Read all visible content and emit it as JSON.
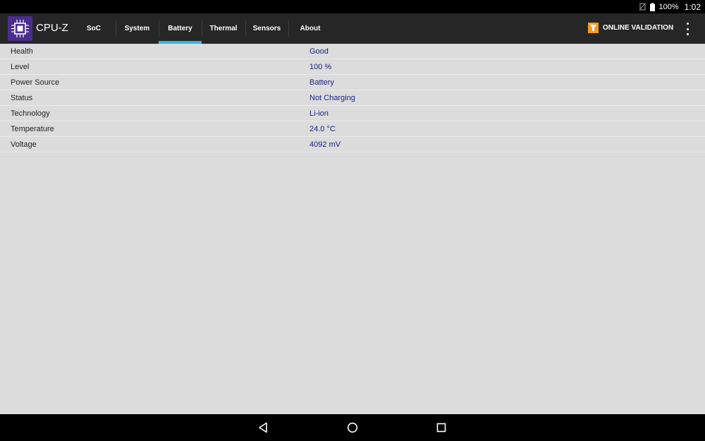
{
  "status_bar": {
    "battery_percent": "100%",
    "clock": "1:02"
  },
  "app": {
    "title": "CPU-Z"
  },
  "tabs": [
    {
      "label": "SoC",
      "active": false
    },
    {
      "label": "System",
      "active": false
    },
    {
      "label": "Battery",
      "active": true
    },
    {
      "label": "Thermal",
      "active": false
    },
    {
      "label": "Sensors",
      "active": false
    },
    {
      "label": "About",
      "active": false
    }
  ],
  "actions": {
    "validation_label": "ONLINE VALIDATION"
  },
  "battery": {
    "rows": [
      {
        "label": "Health",
        "value": "Good"
      },
      {
        "label": "Level",
        "value": "100 %"
      },
      {
        "label": "Power Source",
        "value": "Battery"
      },
      {
        "label": "Status",
        "value": "Not Charging"
      },
      {
        "label": "Technology",
        "value": "Li-ion"
      },
      {
        "label": "Temperature",
        "value": "24.0 °C"
      },
      {
        "label": "Voltage",
        "value": "4092 mV"
      }
    ]
  },
  "colors": {
    "accent": "#33b5e5",
    "appbar": "#262626",
    "value_text": "#1a237e",
    "logo_bg": "#4b2d8c",
    "validation_icon": "#f39c1e"
  },
  "icons": [
    "no-sim-icon",
    "battery-icon",
    "cpu-chip-icon",
    "validation-icon",
    "overflow-menu-icon",
    "back-icon",
    "home-icon",
    "recents-icon"
  ]
}
